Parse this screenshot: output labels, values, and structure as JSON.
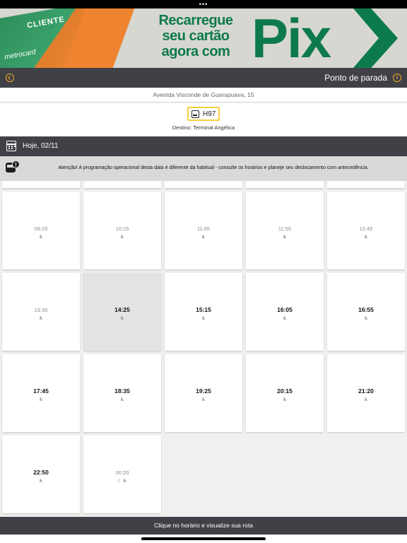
{
  "banner": {
    "headline_line1": "Recarregue",
    "headline_line2": "seu cartão",
    "headline_line3": "agora com",
    "pix": "Pix",
    "card_label": "CLIENTE",
    "card_brand": "metrocard"
  },
  "header": {
    "title": "Ponto de parada"
  },
  "stop": {
    "address": "Avenida Visconde de Guarapuava, 15"
  },
  "line": {
    "code": "H97",
    "destination": "Destino: Terminal Angélica"
  },
  "date": {
    "label": "Hoje, 02/11"
  },
  "alert": {
    "message": "Atenção! A programação operacional desta data é diferente da habitual - consulte os horários e planeje seu deslocamento com antecedência."
  },
  "departures": [
    {
      "time": "09:25",
      "state": "past",
      "icons": "♿"
    },
    {
      "time": "10:15",
      "state": "past",
      "icons": "♿"
    },
    {
      "time": "11:05",
      "state": "past",
      "icons": "♿"
    },
    {
      "time": "11:55",
      "state": "past",
      "icons": "♿"
    },
    {
      "time": "12:45",
      "state": "past",
      "icons": "♿"
    },
    {
      "time": "13:35",
      "state": "past",
      "icons": "♿"
    },
    {
      "time": "14:25",
      "state": "next",
      "icons": "♿"
    },
    {
      "time": "15:15",
      "state": "future",
      "icons": "♿"
    },
    {
      "time": "16:05",
      "state": "future",
      "icons": "♿"
    },
    {
      "time": "16:55",
      "state": "future",
      "icons": "♿"
    },
    {
      "time": "17:45",
      "state": "future",
      "icons": "♿"
    },
    {
      "time": "18:35",
      "state": "future",
      "icons": "♿"
    },
    {
      "time": "19:25",
      "state": "future",
      "icons": "♿"
    },
    {
      "time": "20:15",
      "state": "future",
      "icons": "♿"
    },
    {
      "time": "21:20",
      "state": "future",
      "icons": "♿"
    },
    {
      "time": "22:50",
      "state": "future",
      "icons": "♿"
    },
    {
      "time": "00:20",
      "state": "past",
      "icons": "☾ ♿"
    }
  ],
  "footer": {
    "hint": "Clique no horário e visualize sua rota"
  },
  "colors": {
    "dark_bar": "#3f4146",
    "accent": "#f5a623",
    "line_badge_border": "#f4d03f",
    "brand_green": "#0d7a4c"
  }
}
